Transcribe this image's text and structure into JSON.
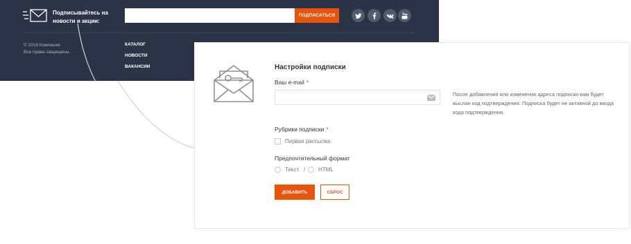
{
  "footer": {
    "subscribe_text": "Подписывайтесь на новости и акции:",
    "subscribe_button": "ПОДПИСАТЬСЯ",
    "social": [
      "twitter-icon",
      "facebook-icon",
      "vk-icon",
      "youtube-icon"
    ],
    "copyright_line1": "© 2016 Компания",
    "copyright_line2": "Все права защищены.",
    "nav": [
      "КАТАЛОГ",
      "НОВОСТИ",
      "ВАКАНСИИ"
    ]
  },
  "panel": {
    "title": "Настройки подписки",
    "email_label": "Ваш e-mail",
    "required_mark": "*",
    "hint": "После добавления или изменения адреса подписки вам будет выслан код подтверждения. Подписка будет не активной до ввода кода подтверждения.",
    "rubrics_label": "Рубрики подписки",
    "rubric_option": "Первая рассылка",
    "format_label": "Предпочтительный формат",
    "format_text": "Текст",
    "format_separator": "/",
    "format_html": "HTML",
    "add_button": "ДОБАВИТЬ",
    "reset_button": "СБРОС"
  },
  "colors": {
    "footer_bg": "#2b3447",
    "accent": "#e9540d",
    "required": "#e74c3c"
  }
}
